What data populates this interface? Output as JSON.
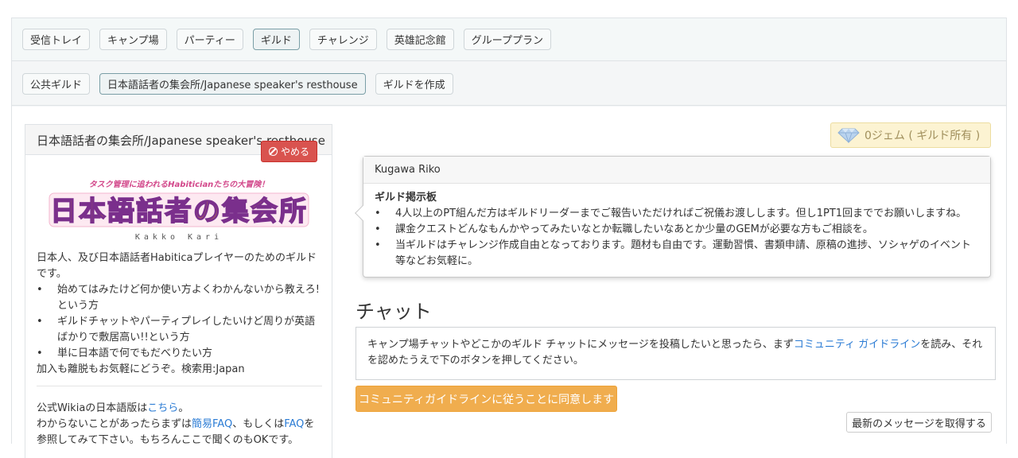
{
  "nav": {
    "tabs": [
      "受信トレイ",
      "キャンプ場",
      "パーティー",
      "ギルド",
      "チャレンジ",
      "英雄記念館",
      "グループプラン"
    ],
    "active_tab": "ギルド"
  },
  "subnav": {
    "tabs": [
      "公共ギルド",
      "日本語話者の集会所/Japanese speaker's resthouse",
      "ギルドを作成"
    ],
    "active_tab": "日本語話者の集会所/Japanese speaker's resthouse"
  },
  "guild": {
    "name": "日本語話者の集会所/Japanese speaker's resthouse",
    "leave_label": "やめる",
    "logo_tagline": "タスク管理に追われるHabiticianたちの大冒険！",
    "logo_text": "日本語話者の集会所",
    "logo_credit": "Kakko Kari",
    "intro": "日本人、及び日本語話者Habiticaプレイヤーのためのギルドです。",
    "bullets": [
      "始めてはみたけど何か使い方よくわかんないから教えろ!という方",
      "ギルドチャットやパーティプレイしたいけど周りが英語ばかりで敷居高い!!という方",
      "単に日本語で何でもだべりたい方"
    ],
    "outro": "加入も離脱もお気軽にどうぞ。検索用:Japan",
    "wiki_prefix": "公式Wikiaの日本語版は",
    "wiki_link": "こちら",
    "wiki_suffix": "。",
    "faq_prefix": "わからないことがあったらまずは",
    "faq_link_1": "簡易FAQ",
    "faq_mid": "、もしくは",
    "faq_link_2": "FAQ",
    "faq_suffix": "を",
    "faq_line2": "参照してみて下さい。もちろんここで聞くのもOKです。"
  },
  "gems": {
    "label": "0ジェム ( ギルド所有 )"
  },
  "popover": {
    "author": "Kugawa Riko",
    "title": "ギルド掲示板",
    "bullets": [
      "4人以上のPT組んだ方はギルドリーダーまでご報告いただければご祝儀お渡しします。但し1PT1回まででお願いしますね。",
      "課金クエストどんなもんかやってみたいなとか転職したいなあとか少量のGEMが必要な方もご相談を。",
      "当ギルドはチャレンジ作成自由となっております。題材も自由です。運動習慣、書類申請、原稿の進捗、ソシャゲのイベント等などお気軽に。"
    ]
  },
  "chat": {
    "title": "チャット",
    "notice_prefix": "キャンプ場チャットやどこかのギルド チャットにメッセージを投稿したいと思ったら、まず",
    "notice_link": "コミュニティ ガイドライン",
    "notice_suffix": "を読み、それを認めたうえで下のボタンを押してください。",
    "agree_label": "コミュニティガイドラインに従うことに同意します",
    "fetch_label": "最新のメッセージを取得する"
  },
  "colors": {
    "accent_link": "#2a7bd4",
    "danger": "#d9534f",
    "warning": "#f0ad4e",
    "gem_bg": "#fcf3d2"
  }
}
